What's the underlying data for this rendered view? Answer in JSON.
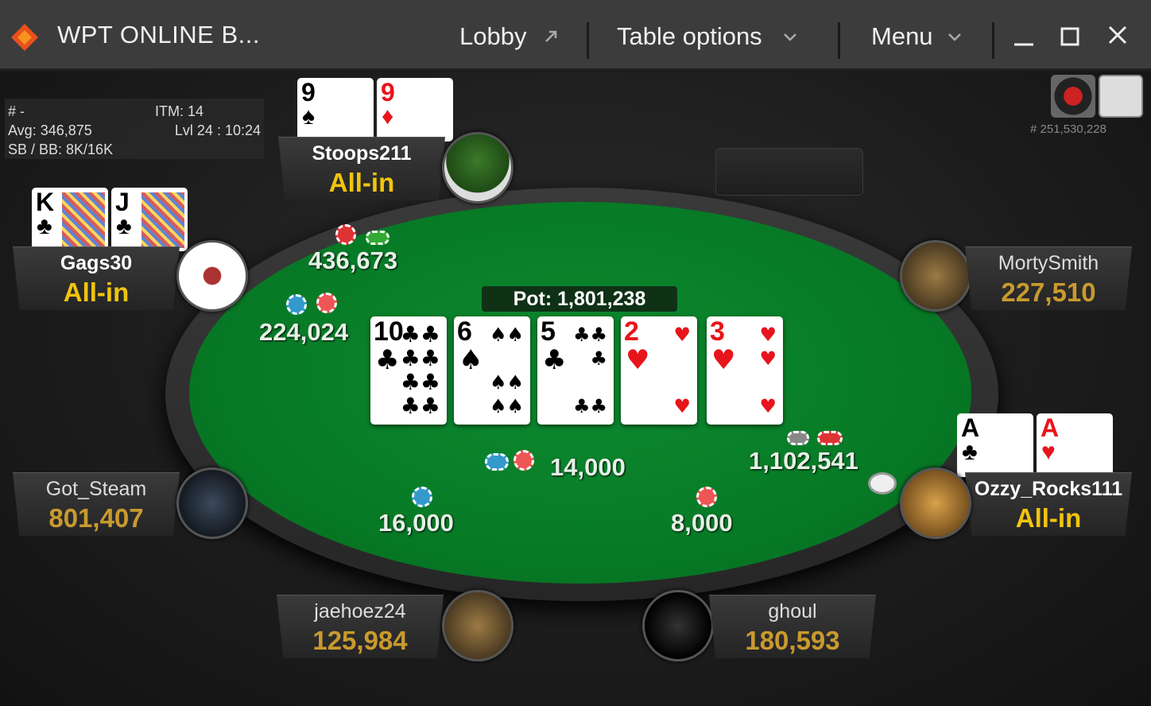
{
  "window": {
    "title": "WPT ONLINE B...",
    "menu": [
      {
        "label": "Lobby",
        "icon": "external-link-icon"
      },
      {
        "label": "Table options",
        "icon": "chevron-down-icon"
      },
      {
        "label": "Menu",
        "icon": "chevron-down-icon"
      }
    ],
    "controls": [
      "minimize-icon",
      "maximize-icon",
      "close-icon"
    ]
  },
  "tournament_info": {
    "number": "# -",
    "itm": "ITM: 14",
    "avg": "Avg: 346,875",
    "level": "Lvl 24 : 10:24",
    "blinds": "SB / BB: 8K/16K"
  },
  "table_id": "# 251,530,228",
  "pot": "Pot: 1,801,238",
  "board": [
    {
      "rank": "10",
      "suit": "♣",
      "color": "black"
    },
    {
      "rank": "6",
      "suit": "♠",
      "color": "black"
    },
    {
      "rank": "5",
      "suit": "♣",
      "color": "black"
    },
    {
      "rank": "2",
      "suit": "♥",
      "color": "red"
    },
    {
      "rank": "3",
      "suit": "♥",
      "color": "red"
    }
  ],
  "players": {
    "stoops": {
      "name": "Stoops211",
      "status": "All-in",
      "cards": [
        {
          "rank": "9",
          "suit": "♠",
          "color": "black"
        },
        {
          "rank": "9",
          "suit": "♦",
          "color": "red"
        }
      ]
    },
    "gags": {
      "name": "Gags30",
      "status": "All-in",
      "cards": [
        {
          "rank": "K",
          "suit": "♣",
          "color": "black"
        },
        {
          "rank": "J",
          "suit": "♣",
          "color": "black"
        }
      ]
    },
    "morty": {
      "name": "MortySmith",
      "stack": "227,510"
    },
    "ozzy": {
      "name": "Ozzy_Rocks111",
      "status": "All-in",
      "cards": [
        {
          "rank": "A",
          "suit": "♣",
          "color": "black"
        },
        {
          "rank": "A",
          "suit": "♥",
          "color": "red"
        }
      ]
    },
    "got": {
      "name": "Got_Steam",
      "stack": "801,407"
    },
    "jae": {
      "name": "jaehoez24",
      "stack": "125,984"
    },
    "ghoul": {
      "name": "ghoul",
      "stack": "180,593"
    }
  },
  "bets": {
    "stoops": "436,673",
    "gags": "224,024",
    "ozzy": "1,102,541",
    "center": "14,000",
    "jae": "16,000",
    "ghoul": "8,000"
  },
  "colors": {
    "felt": "#077a26",
    "allin": "#f1c40f",
    "stack": "#c99a2e",
    "brand": "#e8501c"
  }
}
